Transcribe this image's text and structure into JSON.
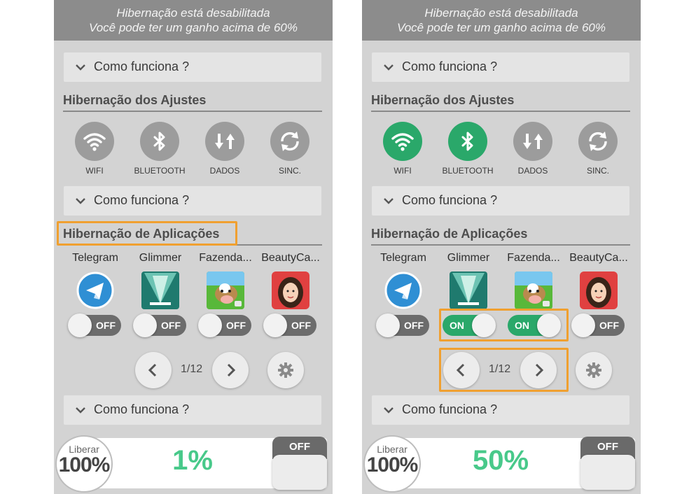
{
  "colors": {
    "accent_green": "#2aa86a",
    "percent_green": "#48c98a",
    "highlight_orange": "#f0a030",
    "banner_gray": "#8c8c8c"
  },
  "left": {
    "banner": {
      "line1": "Hibernação está desabilitada",
      "line2": "Você pode ter um ganho acima de 60%"
    },
    "accordion_top": "Como funciona ?",
    "settings_title": "Hibernação dos Ajustes",
    "settings": [
      {
        "label": "WIFI",
        "icon": "wifi-icon",
        "on": false
      },
      {
        "label": "BLUETOOTH",
        "icon": "bluetooth-icon",
        "on": false
      },
      {
        "label": "DADOS",
        "icon": "data-arrows-icon",
        "on": false
      },
      {
        "label": "SINC.",
        "icon": "sync-icon",
        "on": false
      }
    ],
    "accordion_mid": "Como funciona ?",
    "apps_title": "Hibernação de Aplicações",
    "apps": [
      {
        "name": "Telegram",
        "icon": "telegram-icon",
        "toggle": "OFF"
      },
      {
        "name": "Glimmer",
        "icon": "glimmer-icon",
        "toggle": "OFF"
      },
      {
        "name": "Fazenda...",
        "icon": "farm-cow-icon",
        "toggle": "OFF"
      },
      {
        "name": "BeautyCa...",
        "icon": "beauty-camera-icon",
        "toggle": "OFF"
      }
    ],
    "page_indicator": "1/12",
    "accordion_bottom": "Como funciona ?",
    "footer": {
      "badge_top": "Liberar",
      "badge_value": "100%",
      "percent": "1%",
      "master_toggle": "OFF"
    }
  },
  "right": {
    "banner": {
      "line1": "Hibernação está desabilitada",
      "line2": "Você pode ter um ganho acima de 60%"
    },
    "accordion_top": "Como funciona ?",
    "settings_title": "Hibernação dos Ajustes",
    "settings": [
      {
        "label": "WIFI",
        "icon": "wifi-icon",
        "on": true
      },
      {
        "label": "BLUETOOTH",
        "icon": "bluetooth-icon",
        "on": true
      },
      {
        "label": "DADOS",
        "icon": "data-arrows-icon",
        "on": false
      },
      {
        "label": "SINC.",
        "icon": "sync-icon",
        "on": false
      }
    ],
    "accordion_mid": "Como funciona ?",
    "apps_title": "Hibernação de Aplicações",
    "apps": [
      {
        "name": "Telegram",
        "icon": "telegram-icon",
        "toggle": "OFF"
      },
      {
        "name": "Glimmer",
        "icon": "glimmer-icon",
        "toggle": "ON"
      },
      {
        "name": "Fazenda...",
        "icon": "farm-cow-icon",
        "toggle": "ON"
      },
      {
        "name": "BeautyCa...",
        "icon": "beauty-camera-icon",
        "toggle": "OFF"
      }
    ],
    "page_indicator": "1/12",
    "accordion_bottom": "Como funciona ?",
    "footer": {
      "badge_top": "Liberar",
      "badge_value": "100%",
      "percent": "50%",
      "master_toggle": "OFF"
    }
  }
}
